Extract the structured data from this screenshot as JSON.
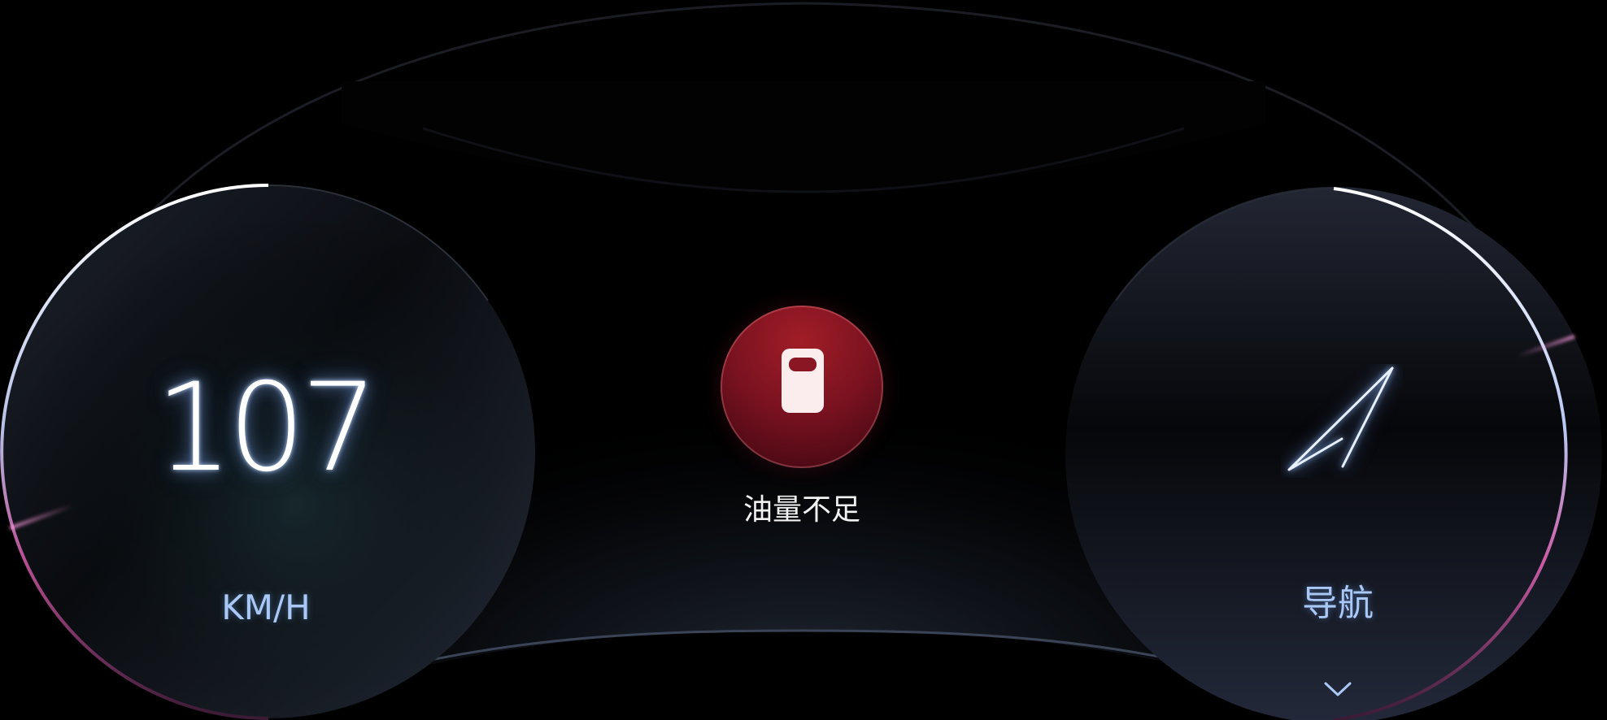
{
  "speedometer": {
    "speed": "107",
    "unit": "KM/H"
  },
  "warning": {
    "icon": "fuel-icon",
    "text": "油量不足",
    "color": "#8a1624"
  },
  "navigation": {
    "icon": "navigation-arrow-icon",
    "label": "导航",
    "expand_icon": "chevron-down-icon"
  },
  "colors": {
    "background": "#000000",
    "label_blue": "#a9c8f5",
    "accent_pink": "#d84fa8"
  }
}
